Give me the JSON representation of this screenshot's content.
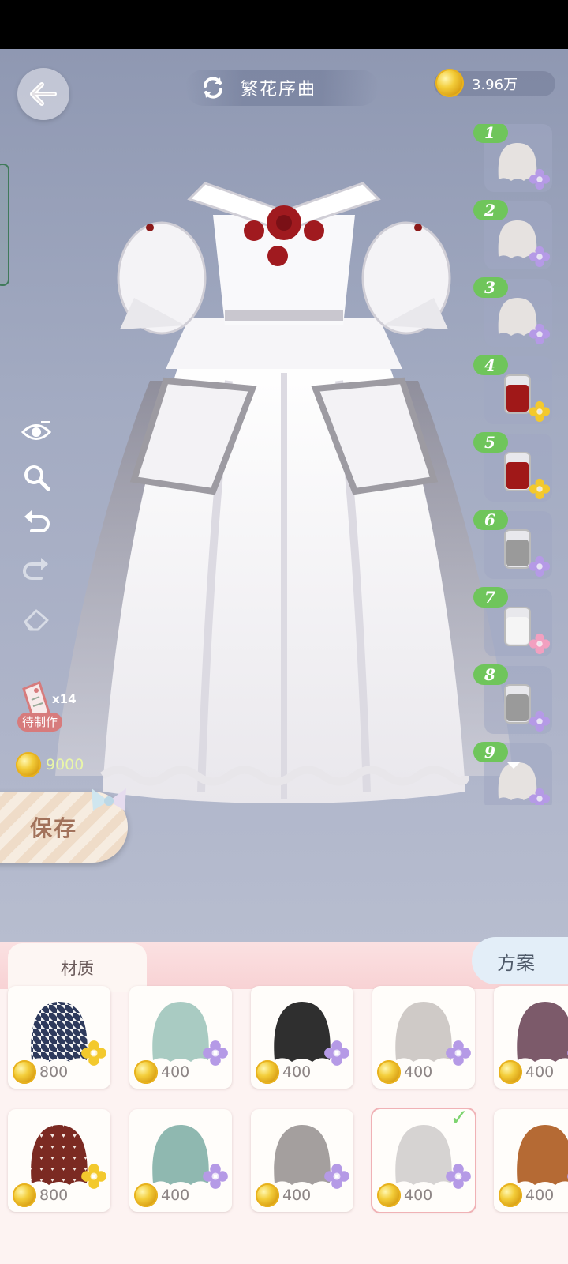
{
  "header": {
    "title": "繁花序曲",
    "coins": "3.96万"
  },
  "left_tools": [
    "eye-icon",
    "zoom-icon",
    "undo-icon",
    "redo-icon",
    "eraser-icon"
  ],
  "craft": {
    "count": "x14",
    "label": "待制作"
  },
  "cost": "9000",
  "save_label": "保存",
  "layers": [
    {
      "num": "1",
      "swatch": "#e6e2e0",
      "kind": "cloth",
      "flower": "#b59ae6"
    },
    {
      "num": "2",
      "swatch": "#e6e2e0",
      "kind": "cloth",
      "flower": "#b59ae6"
    },
    {
      "num": "3",
      "swatch": "#e6e2e0",
      "kind": "cloth",
      "flower": "#b59ae6"
    },
    {
      "num": "4",
      "swatch": "#a01818",
      "kind": "bottle",
      "flower": "#f3c92d"
    },
    {
      "num": "5",
      "swatch": "#a01818",
      "kind": "bottle",
      "flower": "#f3c92d"
    },
    {
      "num": "6",
      "swatch": "#9a9a9a",
      "kind": "bottle",
      "flower": "#b59ae6"
    },
    {
      "num": "7",
      "swatch": "#f5f5f5",
      "kind": "bottle",
      "flower": "#f2a0c0"
    },
    {
      "num": "8",
      "swatch": "#9a9a9a",
      "kind": "bottle",
      "flower": "#b59ae6"
    },
    {
      "num": "9",
      "swatch": "#e6e2e0",
      "kind": "cloth",
      "flower": "#b59ae6"
    }
  ],
  "tabs": {
    "material": "材质",
    "scheme": "方案"
  },
  "materials": [
    {
      "price": "800",
      "color": "#2e3a5c",
      "pattern": "houndstooth",
      "flower": "#f3c92d",
      "selected": false
    },
    {
      "price": "400",
      "color": "#a9cbc2",
      "pattern": "plain",
      "flower": "#b59ae6",
      "selected": false
    },
    {
      "price": "400",
      "color": "#2f2f2f",
      "pattern": "plain",
      "flower": "#b59ae6",
      "selected": false
    },
    {
      "price": "400",
      "color": "#cfcac7",
      "pattern": "plain",
      "flower": "#b59ae6",
      "selected": false
    },
    {
      "price": "400",
      "color": "#7c5a6a",
      "pattern": "plain",
      "flower": "#b59ae6",
      "selected": false
    },
    {
      "price": "800",
      "color": "#7b2a22",
      "pattern": "triangles",
      "flower": "#f3c92d",
      "selected": false
    },
    {
      "price": "400",
      "color": "#8fb8b0",
      "pattern": "plain",
      "flower": "#b59ae6",
      "selected": false
    },
    {
      "price": "400",
      "color": "#a49f9e",
      "pattern": "plain",
      "flower": "#b59ae6",
      "selected": false
    },
    {
      "price": "400",
      "color": "#d6d3d2",
      "pattern": "plain",
      "flower": "#b59ae6",
      "selected": true
    },
    {
      "price": "400",
      "color": "#b56a34",
      "pattern": "plain",
      "flower": "#b59ae6",
      "selected": false
    }
  ]
}
